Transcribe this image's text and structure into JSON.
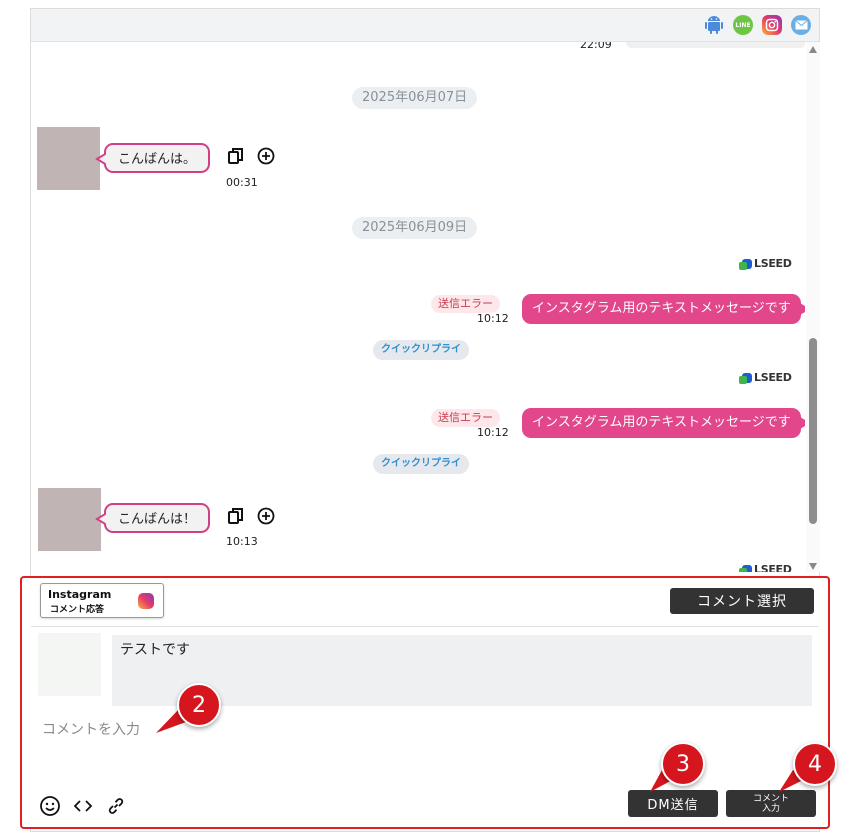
{
  "header": {
    "channel_icons": [
      "android-icon",
      "line-icon",
      "instagram-icon",
      "mail-icon"
    ],
    "line_icon_text": "LINE"
  },
  "chat": {
    "prev_time": "22:09",
    "date_1": "2025年06月07日",
    "msg_1": {
      "text": "こんばんは。",
      "time": "00:31"
    },
    "date_2": "2025年06月09日",
    "lseed_label": "LSEED",
    "out_1": {
      "status": "送信エラー",
      "time": "10:12",
      "text": "インスタグラム用のテキストメッセージです",
      "quick": "クイックリプライ"
    },
    "out_2": {
      "status": "送信エラー",
      "time": "10:12",
      "text": "インスタグラム用のテキストメッセージです",
      "quick": "クイックリプライ"
    },
    "msg_2": {
      "text": "こんばんは！",
      "time": "10:13"
    }
  },
  "panel": {
    "ig_title": "Instagram",
    "ig_subtitle": "コメント応答",
    "select_comment": "コメント選択",
    "quoted_comment": "テストです",
    "input_placeholder": "コメントを入力",
    "dm_send": "DM送信",
    "comment_input_line1": "コメント",
    "comment_input_line2": "入力"
  },
  "markers": [
    "2",
    "3",
    "4"
  ],
  "colors": {
    "accent_pink": "#e2478b",
    "bubble_border": "#d33f86",
    "error_bg": "#fde7ea",
    "highlight_red": "#e02020",
    "marker_red": "#d6161e",
    "dark_button": "#333333"
  }
}
